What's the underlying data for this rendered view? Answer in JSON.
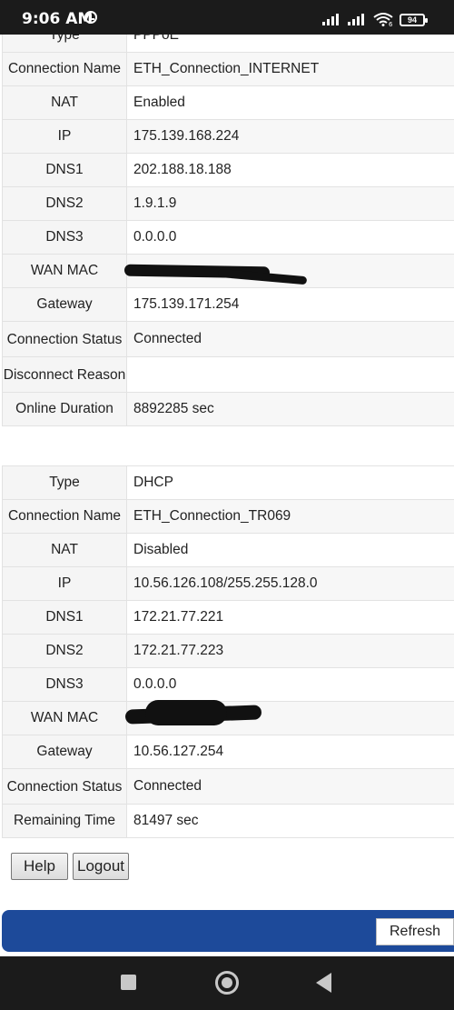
{
  "status_bar": {
    "time": "9:06 AM",
    "battery": "94",
    "wifi_badge": "6"
  },
  "table1": {
    "rows": [
      {
        "label": "Type",
        "value": "PPPoE"
      },
      {
        "label": "Connection Name",
        "value": "ETH_Connection_INTERNET"
      },
      {
        "label": "NAT",
        "value": "Enabled"
      },
      {
        "label": "IP",
        "value": "175.139.168.224"
      },
      {
        "label": "DNS1",
        "value": "202.188.18.188"
      },
      {
        "label": "DNS2",
        "value": "1.9.1.9"
      },
      {
        "label": "DNS3",
        "value": "0.0.0.0"
      },
      {
        "label": "WAN MAC",
        "value": ""
      },
      {
        "label": "Gateway",
        "value": "175.139.171.254"
      },
      {
        "label": "Connection Status",
        "value": "Connected"
      },
      {
        "label": "Disconnect Reason",
        "value": ""
      },
      {
        "label": "Online Duration",
        "value": "8892285 sec"
      }
    ]
  },
  "table2": {
    "rows": [
      {
        "label": "Type",
        "value": "DHCP"
      },
      {
        "label": "Connection Name",
        "value": "ETH_Connection_TR069"
      },
      {
        "label": "NAT",
        "value": "Disabled"
      },
      {
        "label": "IP",
        "value": "10.56.126.108/255.255.128.0"
      },
      {
        "label": "DNS1",
        "value": "172.21.77.221"
      },
      {
        "label": "DNS2",
        "value": "172.21.77.223"
      },
      {
        "label": "DNS3",
        "value": "0.0.0.0"
      },
      {
        "label": "WAN MAC",
        "value": ""
      },
      {
        "label": "Gateway",
        "value": "10.56.127.254"
      },
      {
        "label": "Connection Status",
        "value": "Connected"
      },
      {
        "label": "Remaining Time",
        "value": "81497 sec"
      }
    ]
  },
  "buttons": {
    "help": "Help",
    "logout": "Logout",
    "refresh": "Refresh"
  },
  "colors": {
    "accent_bar": "#1d4a9a",
    "system_bars": "#1b1b1b"
  },
  "icons": {
    "status": [
      "alarm-icon",
      "signal-icon",
      "signal-icon",
      "wifi-icon",
      "battery-icon"
    ],
    "nav": [
      "recents-icon",
      "home-icon",
      "back-icon"
    ]
  }
}
